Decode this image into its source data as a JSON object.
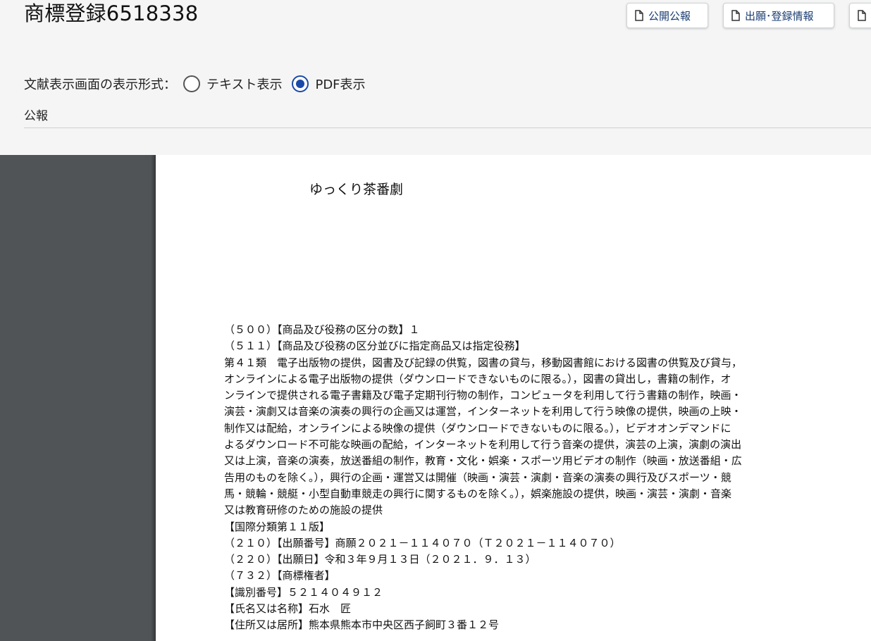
{
  "header": {
    "title": "商標登録6518338",
    "buttons": [
      {
        "label": "公開公報",
        "icon": "document-icon"
      },
      {
        "label": "出願･登録情報",
        "icon": "document-icon"
      },
      {
        "label": "",
        "icon": "document-icon"
      }
    ]
  },
  "display_format": {
    "label": "文献表示画面の表示形式：",
    "options": [
      {
        "label": "テキスト表示",
        "selected": false
      },
      {
        "label": "PDF表示",
        "selected": true
      }
    ]
  },
  "section": {
    "label": "公報"
  },
  "document": {
    "mark_text": "ゆっくり茶番劇",
    "lines": [
      "（５００）【商品及び役務の区分の数】１",
      "（５１１）【商品及び役務の区分並びに指定商品又は指定役務】",
      "第４１類　電子出版物の提供，図書及び記録の供覧，図書の貸与，移動図書館における図書の供覧及び貸与，",
      "オンラインによる電子出版物の提供（ダウンロードできないものに限る。），図書の貸出し，書籍の制作，オ",
      "ンラインで提供される電子書籍及び電子定期刊行物の制作，コンピュータを利用して行う書籍の制作，映画・",
      "演芸・演劇又は音楽の演奏の興行の企画又は運営，インターネットを利用して行う映像の提供，映画の上映・",
      "制作又は配給，オンラインによる映像の提供（ダウンロードできないものに限る。），ビデオオンデマンドに",
      "よるダウンロード不可能な映画の配給，インターネットを利用して行う音楽の提供，演芸の上演，演劇の演出",
      "又は上演，音楽の演奏，放送番組の制作，教育・文化・娯楽・スポーツ用ビデオの制作（映画・放送番組・広",
      "告用のものを除く。），興行の企画・運営又は開催（映画・演芸・演劇・音楽の演奏の興行及びスポーツ・競",
      "馬・競輪・競艇・小型自動車競走の興行に関するものを除く。），娯楽施設の提供，映画・演芸・演劇・音楽",
      "又は教育研修のための施設の提供",
      "【国際分類第１１版】",
      "（２１０）【出願番号】商願２０２１－１１４０７０（Ｔ２０２１－１１４０７０）",
      "（２２０）【出願日】令和３年９月１３日（２０２１．９．１３）",
      "（７３２）【商標権者】",
      "【識別番号】５２１４０４９１２",
      "【氏名又は名称】石水　匠",
      "【住所又は居所】熊本県熊本市中央区西子飼町３番１２号"
    ]
  }
}
